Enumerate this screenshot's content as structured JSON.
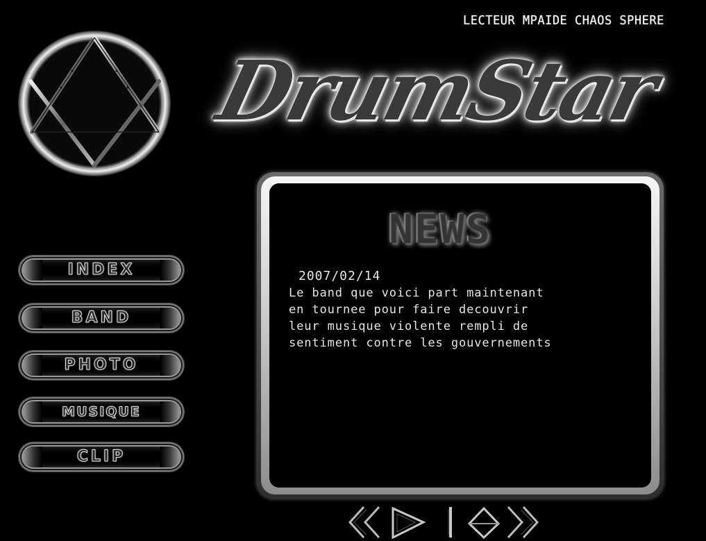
{
  "header": {
    "player_title": "LECTEUR MPAIDE CHAOS SPHERE",
    "brand_name": "DrumStar"
  },
  "emblem": {
    "icon": "triangle-in-circle-emblem-icon"
  },
  "nav": {
    "items": [
      {
        "label": "INDEX"
      },
      {
        "label": "BAND"
      },
      {
        "label": "PHOTO"
      },
      {
        "label": "MUSIQUE"
      },
      {
        "label": "CLIP"
      }
    ]
  },
  "news": {
    "heading": "NEWS",
    "date": "2007/02/14",
    "lines": [
      "Le band que voici part maintenant",
      "en tournee pour faire decouvrir",
      "leur musique violente rempli de",
      "sentiment contre les gouvernements"
    ]
  },
  "player_controls": {
    "icons": [
      "rewind-icon",
      "play-icon",
      "pause-icon",
      "stop-icon",
      "fast-forward-icon"
    ]
  },
  "colors": {
    "background": "#000000",
    "chrome_light": "#e0e0e0",
    "chrome_dark": "#3a3a3a"
  }
}
